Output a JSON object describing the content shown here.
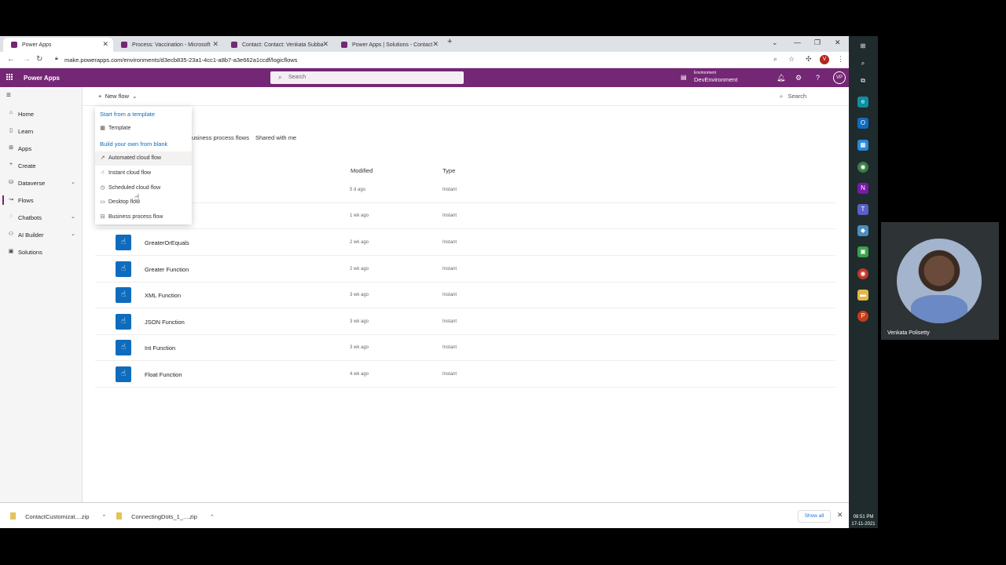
{
  "browser": {
    "tabs": [
      {
        "label": "Power Apps",
        "favicon_color": "#742774"
      },
      {
        "label": "Process: Vaccination - Microsoft",
        "favicon_color": "#742774"
      },
      {
        "label": "Contact: Contact: Venkata Subba",
        "favicon_color": "#742774"
      },
      {
        "label": "Power Apps | Solutions - Contact",
        "favicon_color": "#742774"
      }
    ],
    "url": "make.powerapps.com/environments/d3ecb835-23a1-4cc1-a8b7-a3e662a1ccdf/logicflows",
    "profile_initial": "V"
  },
  "header": {
    "app_name": "Power Apps",
    "search_placeholder": "Search",
    "environment_label": "Environment",
    "environment_name": "DevEnvironment",
    "avatar_initials": "VP",
    "brand_color": "#742774"
  },
  "leftnav": {
    "items": [
      {
        "label": "Home",
        "icon": "home-icon"
      },
      {
        "label": "Learn",
        "icon": "book-icon"
      },
      {
        "label": "Apps",
        "icon": "apps-icon"
      },
      {
        "label": "Create",
        "icon": "plus-icon"
      },
      {
        "label": "Dataverse",
        "icon": "database-icon"
      },
      {
        "label": "Flows",
        "icon": "flow-icon"
      },
      {
        "label": "Chatbots",
        "icon": "chatbot-icon"
      },
      {
        "label": "AI Builder",
        "icon": "ai-builder-icon"
      },
      {
        "label": "Solutions",
        "icon": "solutions-icon"
      }
    ],
    "selected": "Flows"
  },
  "commandbar": {
    "new_flow_label": "New flow",
    "search_label": "Search"
  },
  "pivots": [
    "usiness process flows",
    "Shared with me"
  ],
  "table": {
    "columns": [
      "Modified",
      "Type"
    ],
    "rows": [
      {
        "name": "",
        "modified": "5 d ago",
        "type": "Instant"
      },
      {
        "name": "",
        "modified": "1 wk ago",
        "type": "Instant"
      },
      {
        "name": "GreaterOrEquals",
        "modified": "2 wk ago",
        "type": "Instant"
      },
      {
        "name": "Greater Function",
        "modified": "2 wk ago",
        "type": "Instant"
      },
      {
        "name": "XML Function",
        "modified": "3 wk ago",
        "type": "Instant"
      },
      {
        "name": "JSON Function",
        "modified": "3 wk ago",
        "type": "Instant"
      },
      {
        "name": "Int Function",
        "modified": "3 wk ago",
        "type": "Instant"
      },
      {
        "name": "Float Function",
        "modified": "4 wk ago",
        "type": "Instant"
      }
    ]
  },
  "dropdown": {
    "section1": "Start from a template",
    "template_label": "Template",
    "section2": "Build your own from blank",
    "items": [
      "Automated cloud flow",
      "Instant cloud flow",
      "Scheduled cloud flow",
      "Desktop flow",
      "Business process flow"
    ]
  },
  "downloads": {
    "items": [
      "ContactCustomizat....zip",
      "ConnectingDots_1_....zip"
    ],
    "show_all": "Show all"
  },
  "taskbar": {
    "time": "08:51 PM",
    "date": "17-11-2021"
  },
  "webcam": {
    "name": "Venkata Polisetty"
  }
}
